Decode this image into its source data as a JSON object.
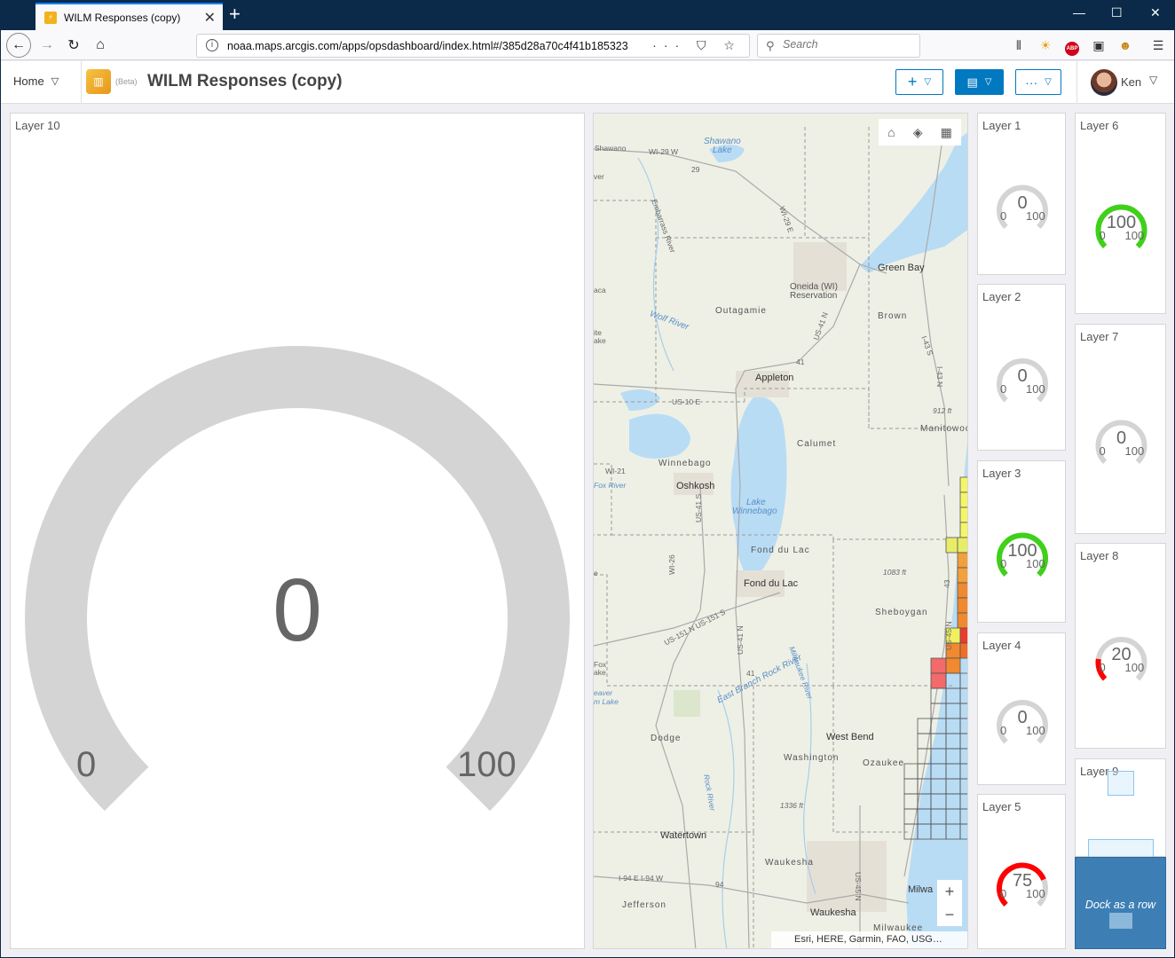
{
  "browser": {
    "tab_title": "WILM Responses (copy)",
    "url": "noaa.maps.arcgis.com/apps/opsdashboard/index.html#/385d28a70c4f41b185323",
    "search_placeholder": "Search"
  },
  "header": {
    "home_label": "Home",
    "beta_label": "(Beta)",
    "title": "WILM Responses (copy)",
    "user_name": "Ken"
  },
  "colors": {
    "accent": "#0079c1",
    "gauge_track": "#d4d4d4",
    "gauge_green": "#3fd11a",
    "gauge_red": "#ff0000"
  },
  "main_gauge": {
    "label": "Layer 10",
    "value": "0",
    "min": "0",
    "max": "100",
    "fraction": 0
  },
  "gauges": [
    {
      "label": "Layer 1",
      "value": "0",
      "min": "0",
      "max": "100",
      "fraction": 0,
      "color": "#3fd11a"
    },
    {
      "label": "Layer 2",
      "value": "0",
      "min": "0",
      "max": "100",
      "fraction": 0,
      "color": "#3fd11a"
    },
    {
      "label": "Layer 3",
      "value": "100",
      "min": "0",
      "max": "100",
      "fraction": 1,
      "color": "#3fd11a"
    },
    {
      "label": "Layer 4",
      "value": "0",
      "min": "0",
      "max": "100",
      "fraction": 0,
      "color": "#3fd11a"
    },
    {
      "label": "Layer 5",
      "value": "75",
      "min": "0",
      "max": "100",
      "fraction": 0.75,
      "color": "#ff0000"
    },
    {
      "label": "Layer 6",
      "value": "100",
      "min": "0",
      "max": "100",
      "fraction": 1,
      "color": "#3fd11a"
    },
    {
      "label": "Layer 7",
      "value": "0",
      "min": "0",
      "max": "100",
      "fraction": 0,
      "color": "#3fd11a"
    },
    {
      "label": "Layer 8",
      "value": "20",
      "min": "0",
      "max": "100",
      "fraction": 0.2,
      "color": "#ff0000"
    }
  ],
  "layer9_label": "Layer 9",
  "map": {
    "labels": {
      "shawano": "Shawano",
      "shawano_lake": "Shawano Lake",
      "green_bay": "Green Bay",
      "oneida": "Oneida (WI)",
      "reservation": "Reservation",
      "outagamie": "Outagamie",
      "brown": "Brown",
      "wolf_river": "Wolf River",
      "appleton": "Appleton",
      "calumet": "Calumet",
      "winnebago": "Winnebago",
      "oshkosh": "Oshkosh",
      "lake": "Lake",
      "lake_winnebago": "Winnebago",
      "fond_du_lac_co": "Fond du Lac",
      "fond_du_lac": "Fond du Lac",
      "sheboygan": "Sheboygan",
      "manitowoc": "Manitowoc",
      "elev_912": "912 ft",
      "elev_1083": "1083 ft",
      "elev_1336": "1336 ft",
      "dodge": "Dodge",
      "west_bend": "West Bend",
      "washington": "Washington",
      "ozaukee": "Ozaukee",
      "watertown": "Watertown",
      "waukesha_co": "Waukesha",
      "waukesha": "Waukesha",
      "jefferson": "Jefferson",
      "milwaukee": "Milwaukee",
      "milwa": "Milwa",
      "fox_lake": "Fox Lake",
      "beaver_dam_lake": "Beaver",
      "beaver_lake2": "m Lake",
      "east_branch_rock": "East Branch Rock River",
      "rock_river": "Rock River",
      "milwaukee_river": "Milwaukee River",
      "embarrass": "Embarrass River",
      "wi29": "WI-29 W",
      "wi29e": "WI-29 E",
      "rt29": "29",
      "us10": "US-10 E",
      "wi21": "WI-21",
      "fox_river": "Fox River",
      "wi26": "WI-26",
      "us41": "US-41 N",
      "us41s": "US-41 S",
      "rt41": "41",
      "rt41b": "41",
      "us151": "US-151 N  US-151 S",
      "i43s": "I-43 S",
      "i43n": "I-43 N",
      "rt43": "43",
      "us41n2": "US-41 N",
      "i94": "I-94 E  I-94 W",
      "rt94": "94",
      "us45": "US-45 N",
      "river": "River",
      "shawano2": "Shawano",
      "ver": "ver",
      "aca": "aca",
      "ite": "ite",
      "ake": "ake",
      "e": "e",
      "fox": "Fox",
      "ake2": "ake",
      "eaver": "eaver"
    },
    "attribution": "Esri, HERE, Garmin, FAO, USG…",
    "tools": [
      "home-icon",
      "layers-icon",
      "qr-icon"
    ]
  },
  "dock_label": "Dock as a row"
}
